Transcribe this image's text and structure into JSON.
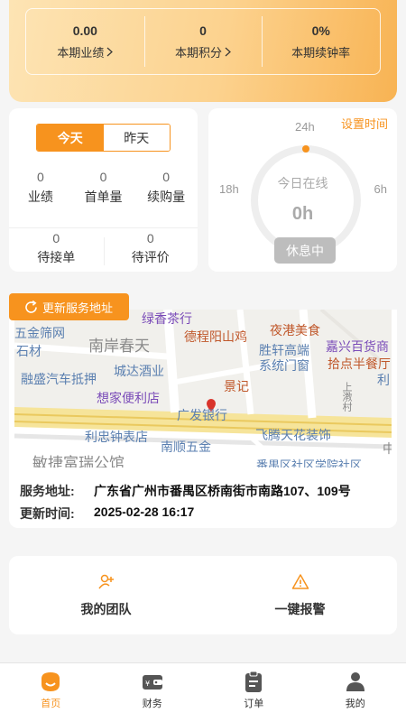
{
  "summary": {
    "stats": [
      {
        "value": "0.00",
        "label": "本期业绩",
        "arrow": true
      },
      {
        "value": "0",
        "label": "本期积分",
        "arrow": true
      },
      {
        "value": "0%",
        "label": "本期续钟率",
        "arrow": false
      }
    ]
  },
  "day_stats": {
    "tabs": [
      "今天",
      "昨天"
    ],
    "active_tab": "今天",
    "top_row": [
      {
        "value": "0",
        "label": "业绩"
      },
      {
        "value": "0",
        "label": "首单量"
      },
      {
        "value": "0",
        "label": "续购量"
      }
    ],
    "bottom_row": [
      {
        "value": "0",
        "label": "待接单"
      },
      {
        "value": "0",
        "label": "待评价"
      }
    ]
  },
  "online": {
    "set_time_label": "设置时间",
    "hour_24": "24h",
    "hour_18": "18h",
    "hour_6": "6h",
    "title": "今日在线",
    "hours": "0h",
    "online_fraction": 0,
    "status_button": "休息中",
    "accent": "#f7931e"
  },
  "map": {
    "refresh_label": "更新服务地址",
    "labels": {
      "l1": "绿香茶行",
      "l2": "五金筛网",
      "l3": "石材",
      "l4": "南岸春天",
      "l5": "德程阳山鸡",
      "l6": "夜港美食",
      "l7": "胜轩高端",
      "l8": "系统门窗",
      "l9": "嘉兴百货商",
      "l10": "拾点半餐厅",
      "l11": "融盛汽车抵押",
      "l12": "城达酒业",
      "l13": "利",
      "l14": "景记",
      "l15": "想家便利店",
      "l16": "广发银行",
      "l17": "飞腾天花装饰",
      "l18": "利忠钟表店",
      "l19": "南顺五金",
      "l20": "敏捷富瑞公馆",
      "l21": "番禺区社区学院社区",
      "l22": "上漖村",
      "l23": "中"
    },
    "address_key": "服务地址:",
    "address_value": "广东省广州市番禺区桥南街市南路107、109号",
    "time_key": "更新时间:",
    "time_value": "2025-02-28 16:17"
  },
  "actions": [
    {
      "label": "我的团队",
      "icon": "add-user-icon"
    },
    {
      "label": "一键报警",
      "icon": "warning-icon"
    }
  ],
  "nav": {
    "items": [
      {
        "label": "首页",
        "icon": "home-icon",
        "active": true
      },
      {
        "label": "财务",
        "icon": "wallet-icon",
        "active": false
      },
      {
        "label": "订单",
        "icon": "clipboard-icon",
        "active": false
      },
      {
        "label": "我的",
        "icon": "user-icon",
        "active": false
      }
    ],
    "active_color": "#f7931e"
  }
}
